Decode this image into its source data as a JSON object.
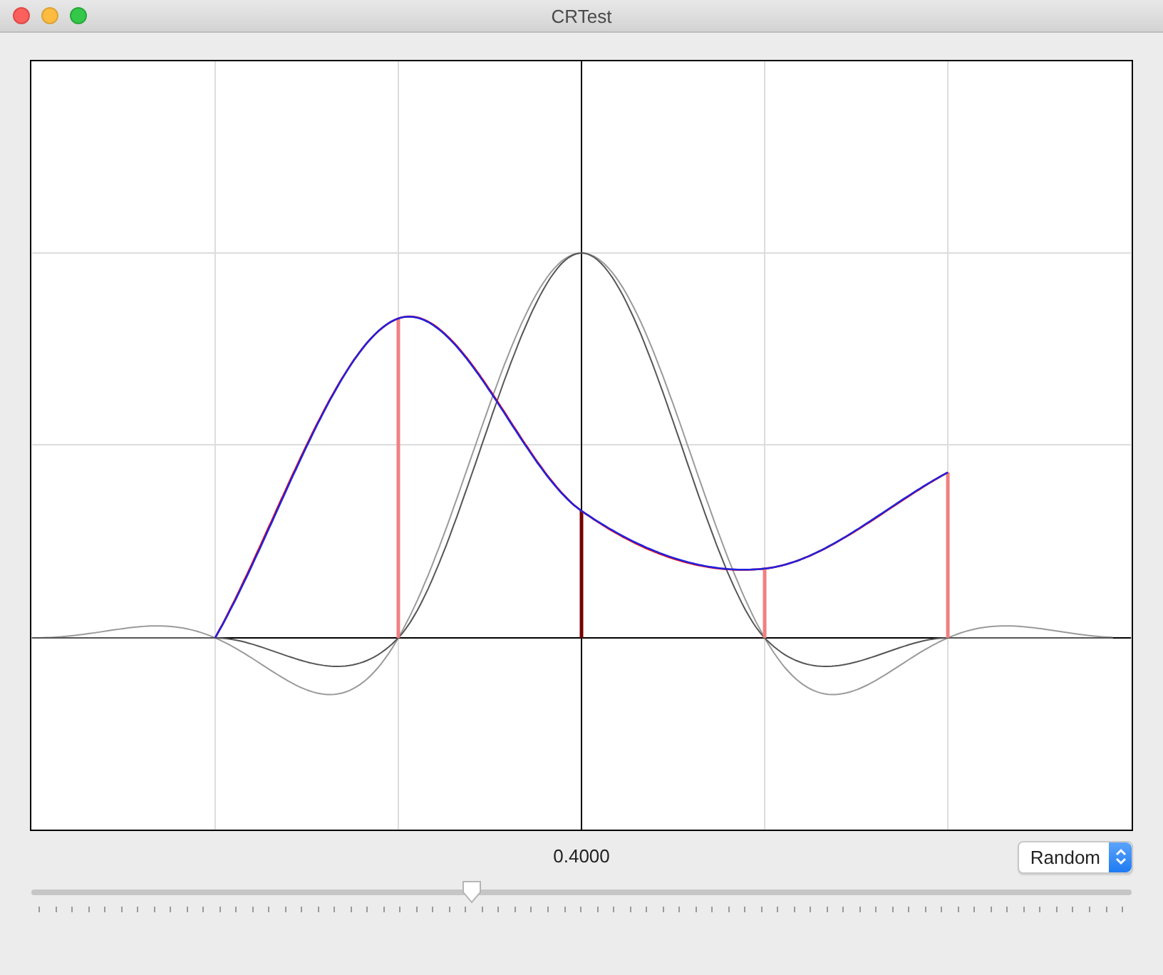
{
  "window": {
    "title": "CRTest"
  },
  "slider": {
    "reading": "0.4000",
    "level": 0.4
  },
  "mode_select": {
    "value": "Random"
  }
}
